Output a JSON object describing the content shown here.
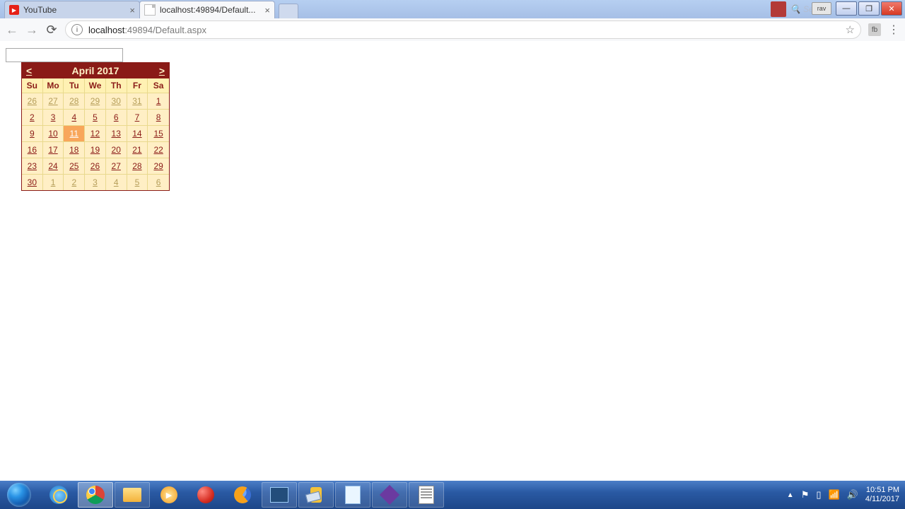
{
  "browser": {
    "tabs": [
      {
        "title": "YouTube"
      },
      {
        "title": "localhost:49894/Default..."
      }
    ],
    "url_domain": "localhost",
    "url_path": ":49894/Default.aspx",
    "win_rav": "rav"
  },
  "calendar": {
    "title": "April 2017",
    "prev": "<",
    "next": ">",
    "day_headers": [
      "Su",
      "Mo",
      "Tu",
      "We",
      "Th",
      "Fr",
      "Sa"
    ],
    "rows": [
      [
        {
          "d": "26",
          "other": true
        },
        {
          "d": "27",
          "other": true
        },
        {
          "d": "28",
          "other": true
        },
        {
          "d": "29",
          "other": true
        },
        {
          "d": "30",
          "other": true
        },
        {
          "d": "31",
          "other": true
        },
        {
          "d": "1"
        }
      ],
      [
        {
          "d": "2"
        },
        {
          "d": "3"
        },
        {
          "d": "4"
        },
        {
          "d": "5"
        },
        {
          "d": "6"
        },
        {
          "d": "7"
        },
        {
          "d": "8"
        }
      ],
      [
        {
          "d": "9"
        },
        {
          "d": "10"
        },
        {
          "d": "11",
          "today": true
        },
        {
          "d": "12"
        },
        {
          "d": "13"
        },
        {
          "d": "14"
        },
        {
          "d": "15"
        }
      ],
      [
        {
          "d": "16"
        },
        {
          "d": "17"
        },
        {
          "d": "18"
        },
        {
          "d": "19"
        },
        {
          "d": "20"
        },
        {
          "d": "21"
        },
        {
          "d": "22"
        }
      ],
      [
        {
          "d": "23"
        },
        {
          "d": "24"
        },
        {
          "d": "25"
        },
        {
          "d": "26"
        },
        {
          "d": "27"
        },
        {
          "d": "28"
        },
        {
          "d": "29"
        }
      ],
      [
        {
          "d": "30"
        },
        {
          "d": "1",
          "other": true
        },
        {
          "d": "2",
          "other": true
        },
        {
          "d": "3",
          "other": true
        },
        {
          "d": "4",
          "other": true
        },
        {
          "d": "5",
          "other": true
        },
        {
          "d": "6",
          "other": true
        }
      ]
    ]
  },
  "taskbar": {
    "time": "10:51 PM",
    "date": "4/11/2017"
  }
}
